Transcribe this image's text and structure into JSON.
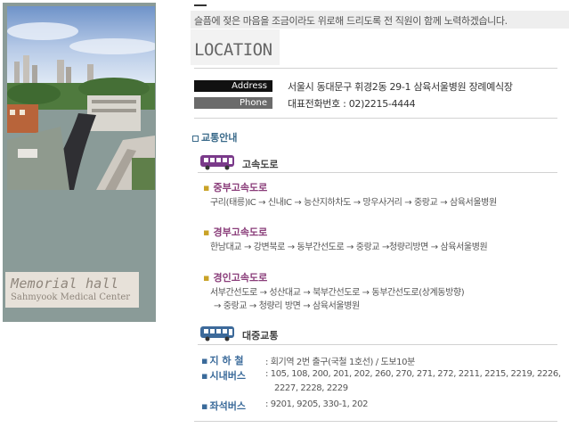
{
  "sidebar": {
    "memorial_title": "Memorial hall",
    "memorial_subtitle": "Sahmyook Medical Center"
  },
  "header": {
    "tagline": "슬픔에 젖은 마음을 조금이라도 위로해 드리도록 전 직원이 함께 노력하겠습니다.",
    "title": "LOCATION"
  },
  "contact": {
    "address_label": "Address",
    "address": "서울시 동대문구 휘경2동 29-1 삼육서울병원 장례예식장",
    "phone_label": "Phone",
    "phone": "대표전화번호 : 02)2215-4444"
  },
  "traffic": {
    "heading": "교통안내",
    "highway": {
      "label": "고속도로",
      "routes": [
        {
          "name": "중부고속도로",
          "path": "구리(태릉)IC → 신내IC → 능산지하차도 → 망우사거리 → 중랑교 → 삼육서울병원"
        },
        {
          "name": "경부고속도로",
          "path": "한남대교 → 강변북로 → 동부간선도로 → 중랑교 →청량리방면 →  삼육서울병원"
        },
        {
          "name": "경인고속도로",
          "path": "서부간선도로 → 성산대교 → 북부간선도로 → 동부간선도로(상계동방향)",
          "path2": "→ 중랑교 → 청량리 방면 → 삼육서울병원"
        }
      ]
    },
    "public": {
      "label": "대중교통",
      "subway_label": "지 하 철",
      "subway": ":  회기역 2번 출구(국철 1호선) / 도보10분",
      "city_bus_label": "시내버스",
      "city_bus": ":  105, 108, 200, 201, 202, 260, 270, 271, 272, 2211, 2215, 2219, 2226,",
      "city_bus2": "2227, 2228, 2229",
      "seat_bus_label": "좌석버스",
      "seat_bus": ":  9201, 9205, 330-1, 202"
    }
  },
  "colors": {
    "sidebar_frame": "#8a9b98",
    "route_title": "#8a3d7a",
    "public_label": "#3a6a9a",
    "bus_icon": "#7a3a8a",
    "bus_icon_public": "#3d6a9a"
  }
}
